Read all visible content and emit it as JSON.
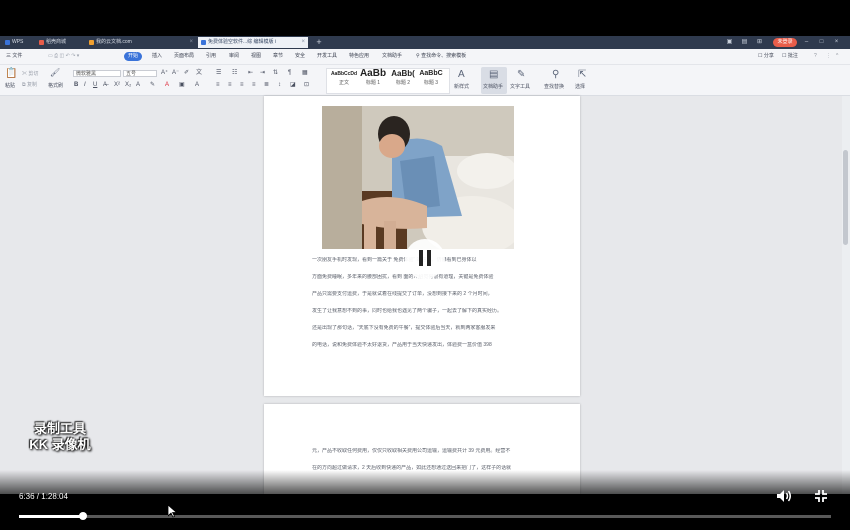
{
  "browser_tabs": [
    {
      "label": "WPS",
      "icon": "wps-icon",
      "color": "#3a73d9"
    },
    {
      "label": "稻壳商城",
      "icon": "docer-icon",
      "color": "#e85d4a"
    },
    {
      "label": "我的云文档.com",
      "icon": "cloud-doc-icon",
      "color": "#f0a030"
    },
    {
      "label": "免费体验空软件...综 编辑模版 i",
      "icon": "document-icon",
      "color": "#3a73d9",
      "active": true
    }
  ],
  "login_label": "未登录",
  "menu": {
    "file": "三 文件",
    "items": [
      "开始",
      "插入",
      "页面布局",
      "引用",
      "审阅",
      "视图",
      "章节",
      "安全",
      "开发工具",
      "特色应用",
      "文档助手"
    ],
    "active_index": 0,
    "search": "查找命令、搜索模板",
    "share": "分享",
    "comment": "批注"
  },
  "toolbar": {
    "paste": "粘贴",
    "cut": "剪切",
    "copy": "复制",
    "format_painter": "格式刷",
    "font_name": "微软雅黑",
    "font_size": "五号",
    "styles": [
      {
        "preview": "AaBbCcDd",
        "label": "正文"
      },
      {
        "preview": "AaBb",
        "label": "标题 1"
      },
      {
        "preview": "AaBb(",
        "label": "标题 2"
      },
      {
        "preview": "AaBbC",
        "label": "标题 3"
      }
    ],
    "new_style": "新样式",
    "text_assistant": "文档助手",
    "text_tools": "文字工具",
    "find_replace": "查找替换",
    "select": "选择"
  },
  "document": {
    "lines": [
      "一次朋友手机时发现，看到一篇关于        免费体验\" 的信息，仿佛看到已身体以",
      "方面免费睡眠，多年来的腰部困扰，看到        面的介绍觉得很有道理，关键是免费体验",
      "产品只需要支付运费，于是就试着在线提交了订单，没想到接下来的 2 个月时间，",
      "发生了让我意想不到的事，同时也给我也遇见了两个骗子，一起去了解下的真实经历。",
      "    还是出现了那句话，“天底下没有免费的午餐”，提交体验后当天，就到两家客服发来",
      "的电话，说和免费体验不太好退货，产品用于当天快递发出，体验费一盒价值 398"
    ],
    "next_page_lines": [
      "元，产品不收取任何费用，仅仅只收取相关费用公司运输，运输费共计 39 元费用。经营不",
      "在的方向超过做请求，2 天后收到快递的产品，如此还想通过送回来把门了，这样子的话就"
    ]
  },
  "player": {
    "current_time": "6:36",
    "total_time": "1:28:04",
    "progress": 0.079,
    "watermark_line1": "录制工具",
    "watermark_line2": "KK 录像机"
  }
}
